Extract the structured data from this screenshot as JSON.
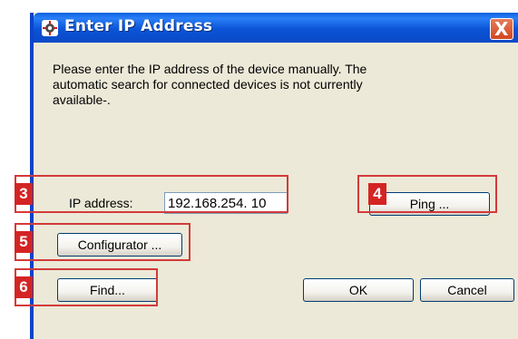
{
  "window": {
    "title": "Enter IP Address",
    "close_glyph": "X"
  },
  "message": "Please enter the IP address of the device manually. The\nautomatic search for connected devices is not currently\navailable-.",
  "form": {
    "ip_label": "IP address:",
    "ip_value": "192.168.254. 10"
  },
  "buttons": {
    "ping": "Ping ...",
    "configurator": "Configurator ...",
    "find": "Find...",
    "ok": "OK",
    "cancel": "Cancel"
  },
  "callouts": [
    "3",
    "4",
    "5",
    "6"
  ],
  "colors": {
    "callout_red": "#d42424",
    "titlebar_blue": "#0b54d8",
    "dialog_bg": "#ece9d8"
  }
}
